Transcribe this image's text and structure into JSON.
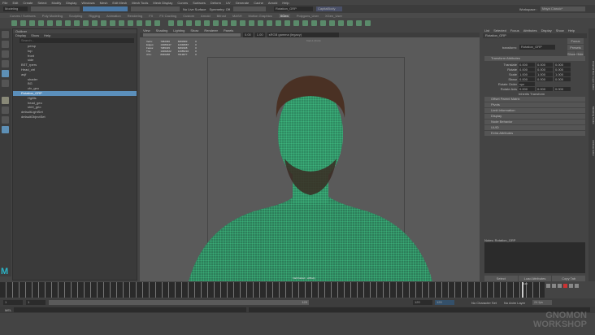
{
  "menubar": [
    "File",
    "Edit",
    "Create",
    "Select",
    "Modify",
    "Display",
    "Windows",
    "Mesh",
    "Edit Mesh",
    "Mesh Tools",
    "Mesh Display",
    "Curves",
    "Surfaces",
    "Deform",
    "UV",
    "Generate",
    "Cache",
    "Arnold",
    "Help"
  ],
  "status": {
    "mode": "Modeling",
    "live_surface": "No Live Surface",
    "symmetry": "Symmetry: Off",
    "object_name": "Rotation_GRP",
    "camera": "CapitalBody",
    "workspace_label": "Workspace :",
    "workspace": "Maya Classic*"
  },
  "shelf_tabs": [
    "Curves / Surfaces",
    "Poly Modeling",
    "Sculpting",
    "Rigging",
    "Animation",
    "Rendering",
    "FX",
    "FX Caching",
    "Custom",
    "Arnold",
    "Bifrost",
    "MASH",
    "Motion Graphics",
    "XGen",
    "Polygons_User",
    "XGen_User"
  ],
  "active_shelf": "XGen",
  "outliner": {
    "title": "Outliner",
    "menu": [
      "Display",
      "Show",
      "Help"
    ],
    "search_placeholder": "Search...",
    "items": [
      {
        "label": "persp",
        "indent": 1
      },
      {
        "label": "top",
        "indent": 1
      },
      {
        "label": "front",
        "indent": 1
      },
      {
        "label": "side",
        "indent": 1
      },
      {
        "label": "BST_rpers",
        "indent": 0
      },
      {
        "label": "Head_ctrl",
        "indent": 0
      },
      {
        "label": "asjf",
        "indent": 0
      },
      {
        "label": "shader",
        "indent": 1
      },
      {
        "label": "BG",
        "indent": 1
      },
      {
        "label": "cfx_geo",
        "indent": 1
      },
      {
        "label": "Rotation_GRP",
        "indent": 0,
        "selected": true
      },
      {
        "label": "Hglills",
        "indent": 1
      },
      {
        "label": "head_geo",
        "indent": 1
      },
      {
        "label": "shirt_geo",
        "indent": 1
      },
      {
        "label": "defaultLightSet",
        "indent": 0
      },
      {
        "label": "defaultObjectSet",
        "indent": 0
      }
    ]
  },
  "viewport": {
    "menu": [
      "View",
      "Shading",
      "Lighting",
      "Show",
      "Renderer",
      "Panels"
    ],
    "gamma": "sRGB gamma (legacy)",
    "field1": "0.00",
    "field2": "1.00",
    "camera_label": "front-1 (front)",
    "hud_label": "FlatShaded - ellBody",
    "hud": [
      [
        "Verts:",
        "7082360",
        "6083983",
        "0"
      ],
      [
        "Edges:",
        "13080347",
        "12048967",
        "0"
      ],
      [
        "Faces:",
        "7085335",
        "6083308",
        "0"
      ],
      [
        "Tris:",
        "14062622",
        "12085216",
        "0"
      ],
      [
        "UVs:",
        "8066288",
        "7019677",
        "0"
      ]
    ]
  },
  "attribute_editor": {
    "menu": [
      "List",
      "Selected",
      "Focus",
      "Attributes",
      "Display",
      "Show",
      "Help"
    ],
    "node_tab": "Rotation_GRP",
    "transform_label": "transform:",
    "transform_value": "Rotation_GRP",
    "focus": "Focus",
    "presets": "Presets",
    "show": "Show",
    "hide": "Hide",
    "section": "Transform Attributes",
    "attrs": [
      {
        "label": "Translate",
        "v": [
          "0.000",
          "0.000",
          "0.000"
        ]
      },
      {
        "label": "Rotate",
        "v": [
          "0.000",
          "0.000",
          "0.000"
        ]
      },
      {
        "label": "Scale",
        "v": [
          "1.000",
          "1.000",
          "1.000"
        ]
      },
      {
        "label": "Shear",
        "v": [
          "0.000",
          "0.000",
          "0.000"
        ]
      }
    ],
    "rotate_order_label": "Rotate Order",
    "rotate_order": "xyz",
    "rotate_axis_label": "Rotate Axis",
    "rotate_axis": [
      "0.000",
      "0.000",
      "0.000"
    ],
    "inherits": "Inherits Transform",
    "offset_parent": "Offset Parent Matrix",
    "sections": [
      "Pivots",
      "Limit Information",
      "Display",
      "Node Behavior",
      "UUID",
      "Extra Attributes"
    ],
    "notes_label": "Notes: Rotation_GRP",
    "buttons": [
      "Select",
      "Load Attributes",
      "Copy Tab"
    ]
  },
  "side_tabs": [
    "Channel Box / Layer Editor",
    "Modeling Toolkit",
    "Attribute Editor"
  ],
  "timeline": {
    "start": "1",
    "start2": "1",
    "end": "120",
    "end2": "120",
    "end3": "120",
    "current": "120",
    "no_char_set": "No Character Set",
    "no_anim_layer": "No Anim Layer",
    "fps": "24 fps"
  },
  "command": {
    "lang": "MEL"
  },
  "watermark": {
    "line1": "GNOMON",
    "line2": "WORKSHOP"
  },
  "colors": {
    "accent": "#5b8fbb",
    "mesh": "#4be39a",
    "maya_logo": "#2bb5c8"
  }
}
